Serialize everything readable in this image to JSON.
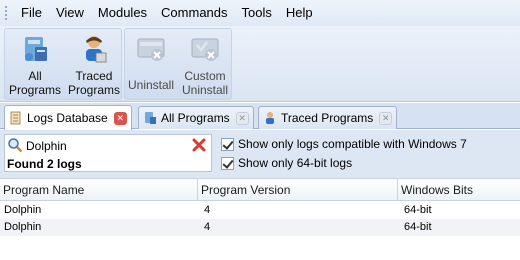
{
  "menu": {
    "items": [
      "File",
      "View",
      "Modules",
      "Commands",
      "Tools",
      "Help"
    ]
  },
  "toolbar": {
    "all_programs": {
      "line1": "All",
      "line2": "Programs"
    },
    "traced_programs": {
      "line1": "Traced",
      "line2": "Programs"
    },
    "uninstall": {
      "line1": "Uninstall"
    },
    "custom_uninstall": {
      "line1": "Custom",
      "line2": "Uninstall"
    }
  },
  "tabs": [
    {
      "label": "Logs Database",
      "active": true
    },
    {
      "label": "All Programs",
      "active": false
    },
    {
      "label": "Traced Programs",
      "active": false
    }
  ],
  "filter": {
    "search_value": "Dolphin",
    "found_text": "Found 2 logs",
    "checkbox_windows7": "Show only logs compatible with Windows 7",
    "checkbox_64bit": "Show only 64-bit logs"
  },
  "grid": {
    "columns": [
      "Program Name",
      "Program Version",
      "Windows Bits"
    ],
    "rows": [
      [
        "Dolphin",
        "4",
        "64-bit"
      ],
      [
        "Dolphin",
        "4",
        "64-bit"
      ]
    ]
  },
  "colors": {
    "accent": "#dde7f3",
    "close_red": "#d9534f"
  }
}
